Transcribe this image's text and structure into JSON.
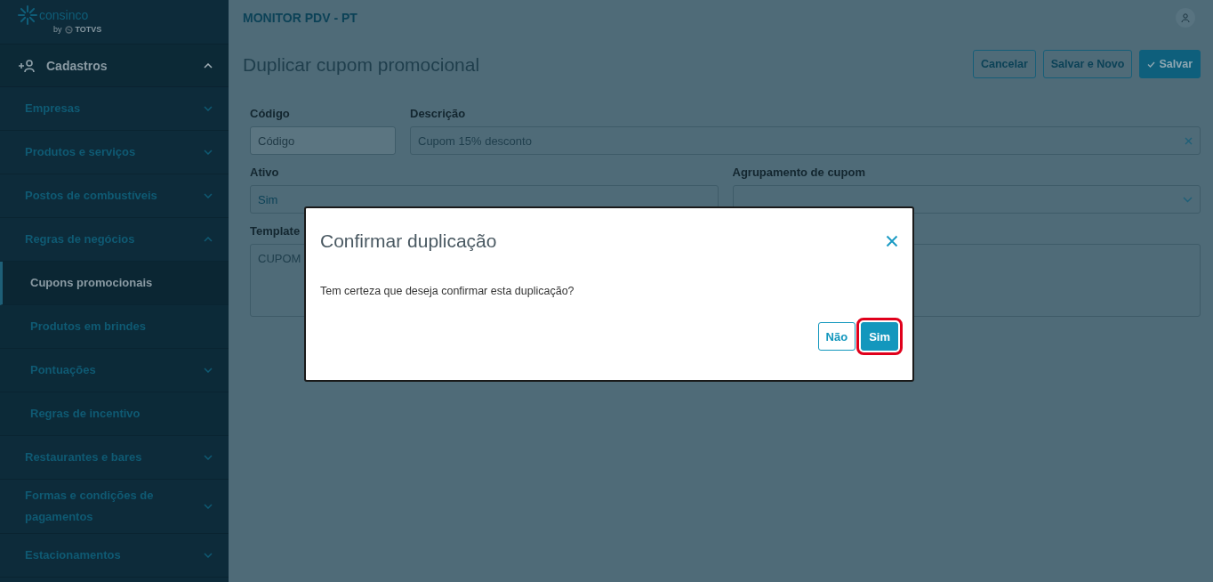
{
  "sidebar": {
    "logo": {
      "name": "consinco",
      "by": "by",
      "brand": "TOTVS"
    },
    "section": {
      "label": "Cadastros",
      "expanded": true,
      "items": [
        {
          "label": "Empresas",
          "kind": "group",
          "expanded": false,
          "selected": false
        },
        {
          "label": "Produtos e serviços",
          "kind": "group",
          "expanded": false,
          "selected": false
        },
        {
          "label": "Postos de combustíveis",
          "kind": "group",
          "expanded": false,
          "selected": false
        },
        {
          "label": "Regras de negócios",
          "kind": "group",
          "expanded": true,
          "selected": false,
          "children": [
            {
              "label": "Cupons promocionais",
              "kind": "link",
              "selected": true
            },
            {
              "label": "Produtos em brindes",
              "kind": "link",
              "selected": false
            },
            {
              "label": "Pontuações",
              "kind": "group",
              "expanded": false,
              "selected": false
            },
            {
              "label": "Regras de incentivo",
              "kind": "link",
              "selected": false
            }
          ]
        },
        {
          "label": "Restaurantes e bares",
          "kind": "group",
          "expanded": false,
          "selected": false
        },
        {
          "label": "Formas e condições de pagamentos",
          "kind": "group",
          "expanded": false,
          "selected": false
        },
        {
          "label": "Estacionamentos",
          "kind": "group",
          "expanded": false,
          "selected": false
        }
      ]
    }
  },
  "header": {
    "app_title": "MONITOR PDV - PT"
  },
  "page": {
    "title": "Duplicar cupom promocional",
    "buttons": [
      {
        "label": "Cancelar",
        "kind": "outline"
      },
      {
        "label": "Salvar e Novo",
        "kind": "outline"
      },
      {
        "label": "Salvar",
        "kind": "primary"
      }
    ],
    "form": {
      "codigo": {
        "label": "Código",
        "placeholder": "Código",
        "disabled": true
      },
      "descricao": {
        "label": "Descrição",
        "value": "Cupom 15% desconto"
      },
      "ativo": {
        "label": "Ativo",
        "value": "Sim"
      },
      "agrupamento": {
        "label": "Agrupamento de cupom"
      },
      "template": {
        "label": "Template",
        "value": "CUPOM"
      }
    }
  },
  "dialog": {
    "title": "Confirmar duplicação",
    "message": "Tem certeza que deseja confirmar esta duplicação?",
    "buttons": [
      {
        "label": "Não",
        "kind": "outline",
        "focused": false
      },
      {
        "label": "Sim",
        "kind": "primary",
        "focused": true
      }
    ]
  }
}
